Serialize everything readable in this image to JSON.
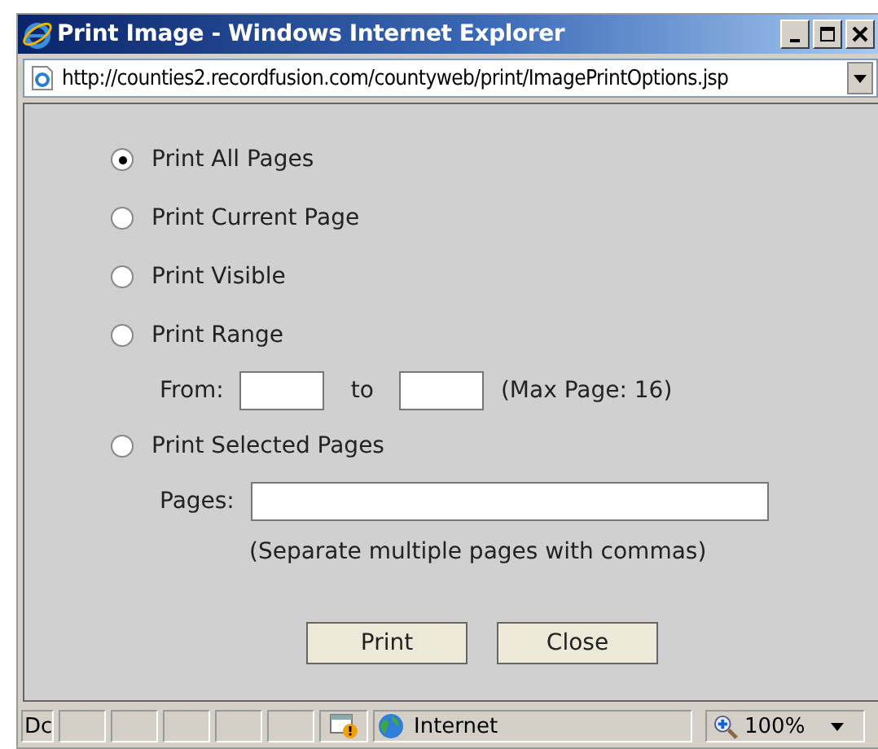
{
  "window": {
    "title": "Print Image - Windows Internet Explorer"
  },
  "address_bar": {
    "url": "http://counties2.recordfusion.com/countyweb/print/ImagePrintOptions.jsp"
  },
  "options": [
    {
      "label": "Print All Pages",
      "selected": true,
      "kind": "plain"
    },
    {
      "label": "Print Current Page",
      "selected": false,
      "kind": "plain"
    },
    {
      "label": "Print Visible",
      "selected": false,
      "kind": "plain"
    },
    {
      "label": "Print Range",
      "selected": false,
      "kind": "range"
    },
    {
      "label": "Print Selected Pages",
      "selected": false,
      "kind": "pages"
    }
  ],
  "range": {
    "from_label": "From:",
    "to_label": "to",
    "max_note": "(Max Page: 16)"
  },
  "pages": {
    "label": "Pages:",
    "hint": "(Separate multiple pages with commas)"
  },
  "buttons": [
    "Print",
    "Close"
  ],
  "status_bar": {
    "text": "Dc",
    "zone": "Internet",
    "zoom": "100%"
  }
}
